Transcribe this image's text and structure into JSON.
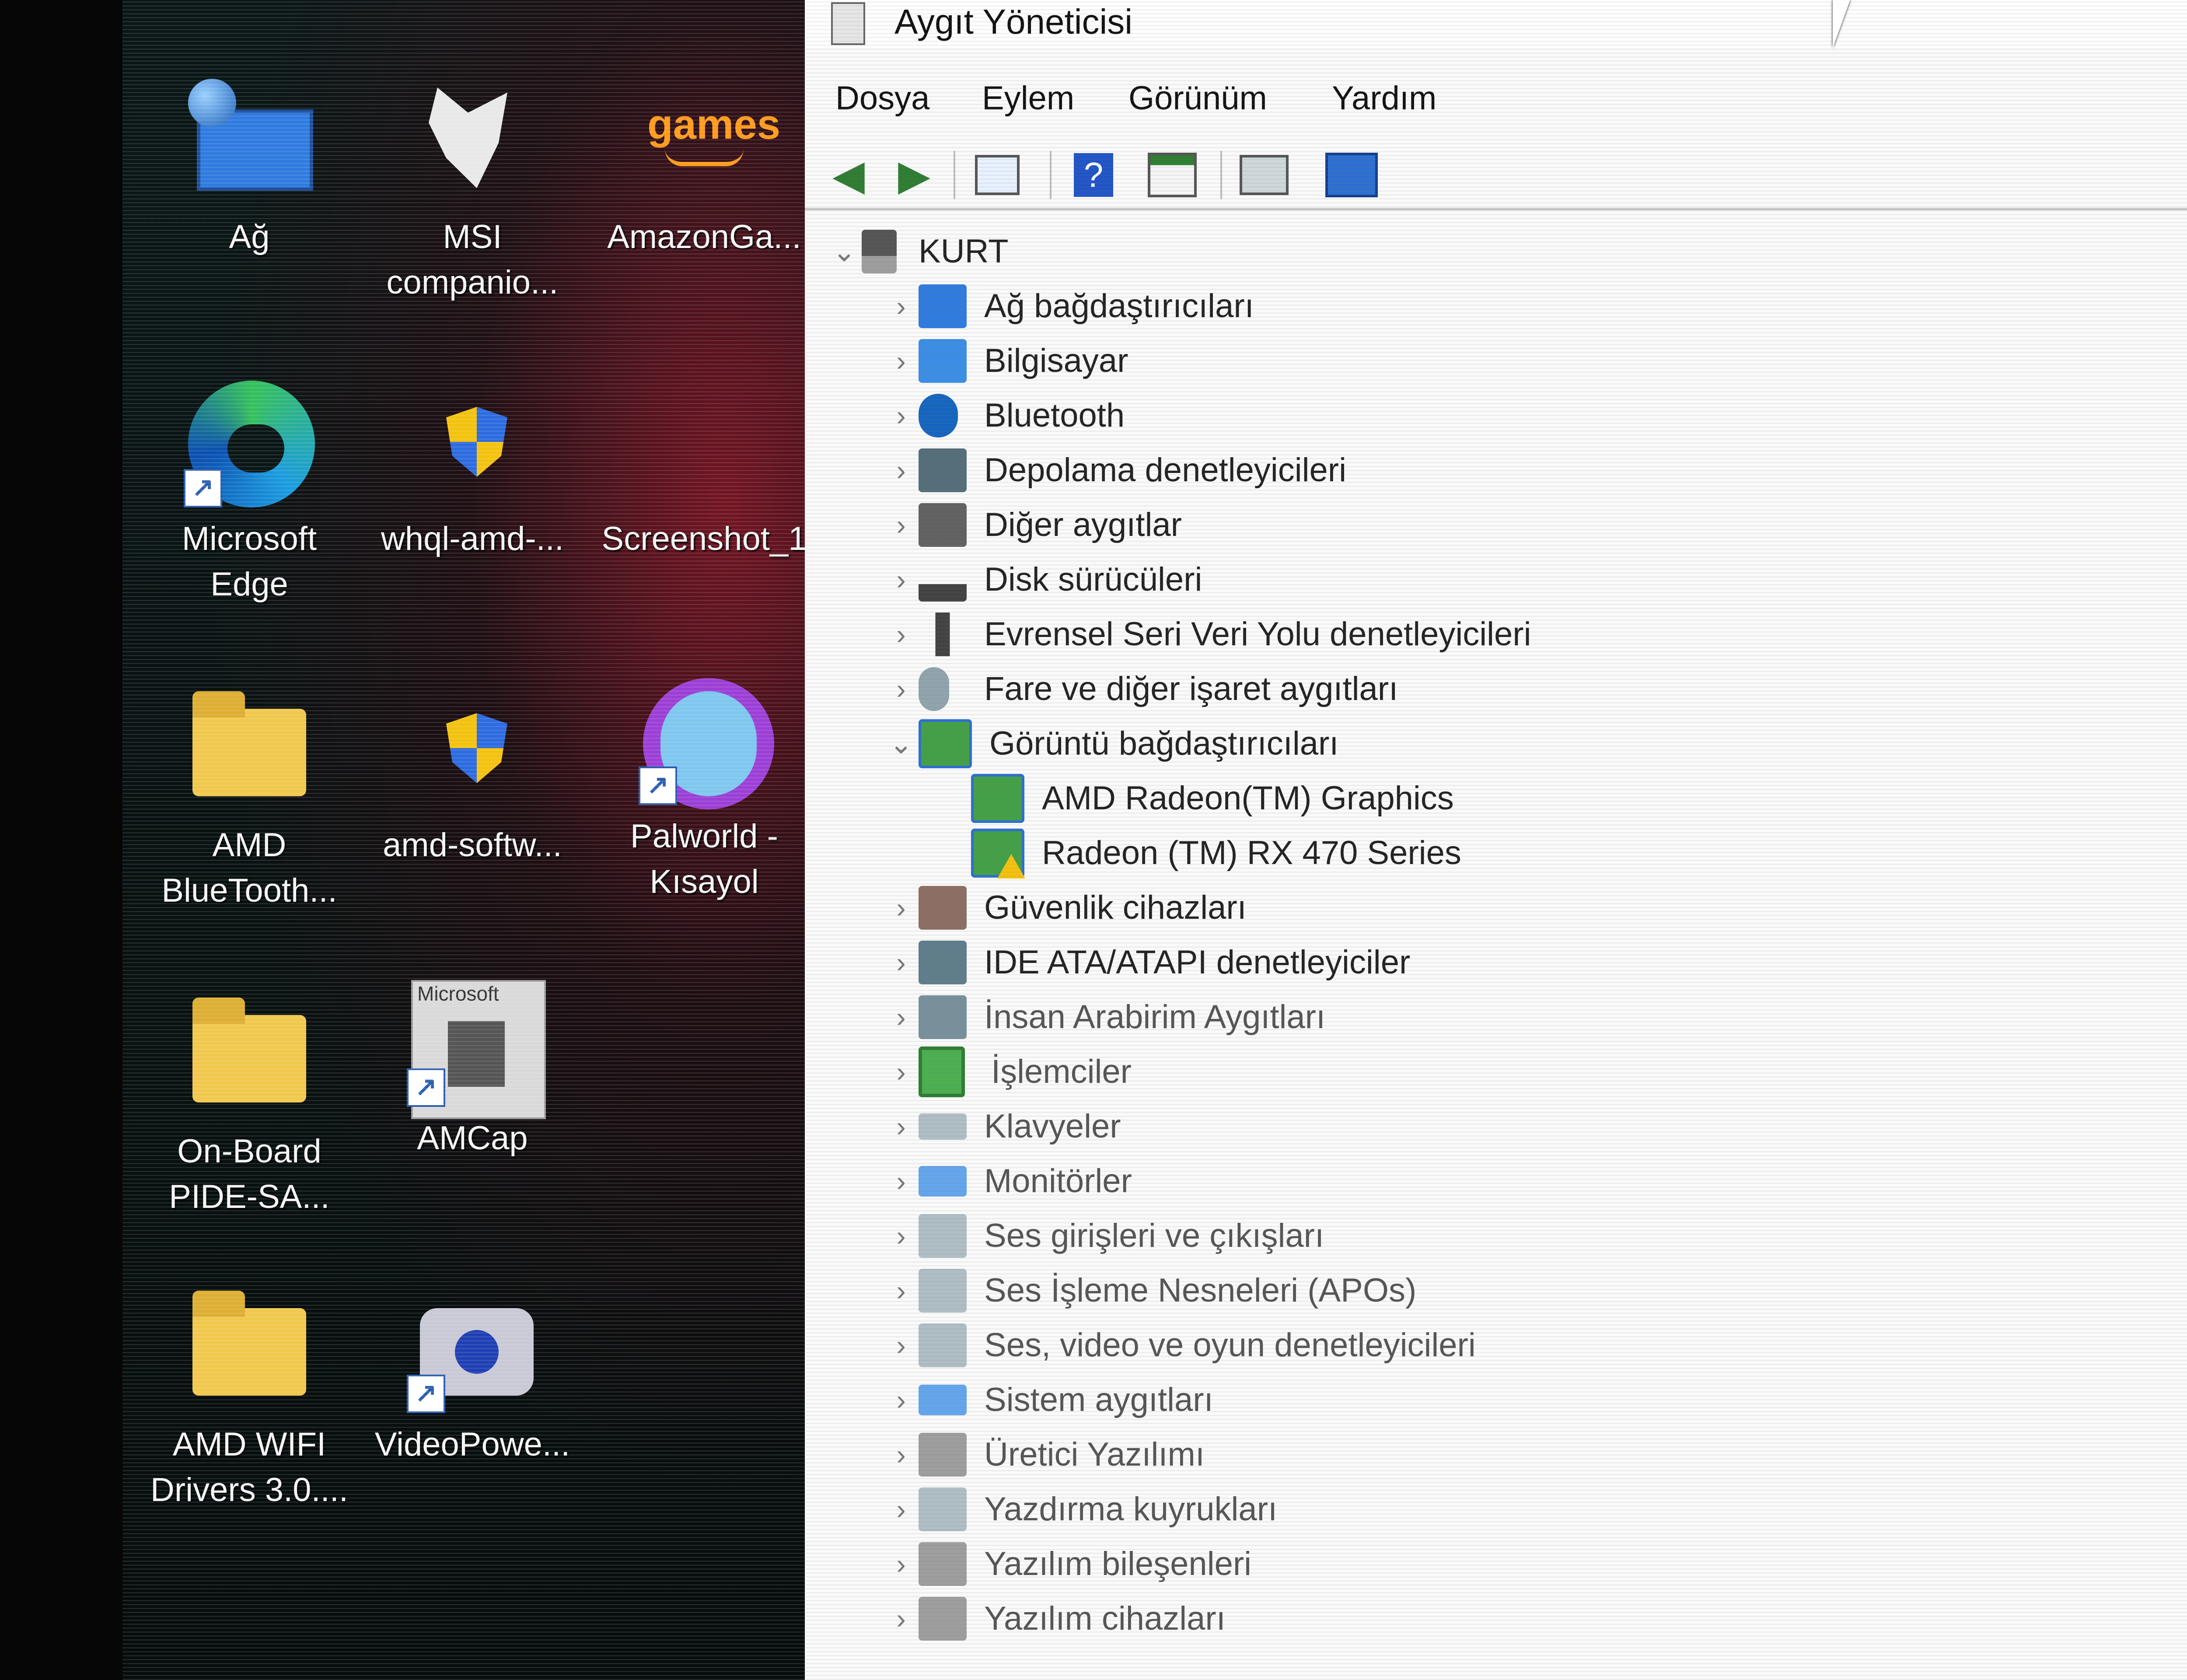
{
  "desktop": {
    "icons": [
      {
        "name": "ag",
        "label": "Ağ",
        "icon": "network-monitor-icon"
      },
      {
        "name": "msi-companion",
        "label": "MSI\ncompanio...",
        "icon": "msi-dragon-icon"
      },
      {
        "name": "amazon-games",
        "label": "AmazonGa...",
        "icon": "amazon-games-icon",
        "icon_text": "games"
      },
      {
        "name": "microsoft-edge",
        "label": "Microsoft\nEdge",
        "icon": "edge-icon"
      },
      {
        "name": "whql-amd",
        "label": "whql-amd-...",
        "icon": "shield-icon"
      },
      {
        "name": "screenshot",
        "label": "Screenshot_1",
        "icon": "image-icon"
      },
      {
        "name": "amd-bluetooth",
        "label": "AMD\nBlueTooth...",
        "icon": "folder-icon"
      },
      {
        "name": "amd-software",
        "label": "amd-softw...",
        "icon": "shield-icon"
      },
      {
        "name": "palworld",
        "label": "Palworld -\nKısayol",
        "icon": "palworld-icon"
      },
      {
        "name": "on-board-pide",
        "label": "On-Board\nPIDE-SA...",
        "icon": "folder-icon"
      },
      {
        "name": "amcap",
        "label": "AMCap",
        "icon": "amcap-icon",
        "icon_text": "Microsoft"
      },
      {
        "name": "amd-wifi",
        "label": "AMD WIFI\nDrivers 3.0....",
        "icon": "folder-icon"
      },
      {
        "name": "videopower",
        "label": "VideoPowe...",
        "icon": "webcam-icon"
      }
    ]
  },
  "window": {
    "title": "Aygıt Yöneticisi",
    "menu": [
      "Dosya",
      "Eylem",
      "Görünüm",
      "Yardım"
    ],
    "toolbar": [
      {
        "name": "back-button",
        "icon": "arrow-left-icon"
      },
      {
        "name": "forward-button",
        "icon": "arrow-right-icon"
      },
      {
        "name": "show-hide-console-tree-button",
        "icon": "console-tree-icon"
      },
      {
        "name": "help-button",
        "icon": "help-icon"
      },
      {
        "name": "properties-button",
        "icon": "properties-icon"
      },
      {
        "name": "scan-hardware-button",
        "icon": "scan-hardware-icon"
      },
      {
        "name": "monitor-button",
        "icon": "monitor-icon"
      }
    ],
    "tree": {
      "root": "KURT",
      "categories": [
        {
          "label": "Ağ bağdaştırıcıları",
          "icon": "network-adapter-icon",
          "expanded": false
        },
        {
          "label": "Bilgisayar",
          "icon": "computer-icon",
          "expanded": false
        },
        {
          "label": "Bluetooth",
          "icon": "bluetooth-icon",
          "expanded": false
        },
        {
          "label": "Depolama denetleyicileri",
          "icon": "storage-controller-icon",
          "expanded": false
        },
        {
          "label": "Diğer aygıtlar",
          "icon": "other-devices-icon",
          "expanded": false
        },
        {
          "label": "Disk sürücüleri",
          "icon": "disk-drive-icon",
          "expanded": false
        },
        {
          "label": "Evrensel Seri Veri Yolu denetleyicileri",
          "icon": "usb-icon",
          "expanded": false
        },
        {
          "label": "Fare ve diğer işaret aygıtları",
          "icon": "mouse-icon",
          "expanded": false
        },
        {
          "label": "Görüntü bağdaştırıcıları",
          "icon": "display-adapter-icon",
          "expanded": true,
          "children": [
            {
              "label": "AMD Radeon(TM) Graphics",
              "icon": "display-adapter-icon",
              "warning": false
            },
            {
              "label": "Radeon (TM) RX 470 Series",
              "icon": "display-adapter-icon",
              "warning": true
            }
          ]
        },
        {
          "label": "Güvenlik cihazları",
          "icon": "security-device-icon",
          "expanded": false
        },
        {
          "label": "IDE ATA/ATAPI denetleyiciler",
          "icon": "ide-controller-icon",
          "expanded": false
        },
        {
          "label": "İnsan Arabirim Aygıtları",
          "icon": "hid-icon",
          "expanded": false
        },
        {
          "label": "İşlemciler",
          "icon": "processor-icon",
          "expanded": false
        },
        {
          "label": "Klavyeler",
          "icon": "keyboard-icon",
          "expanded": false
        },
        {
          "label": "Monitörler",
          "icon": "monitor-icon",
          "expanded": false
        },
        {
          "label": "Ses girişleri ve çıkışları",
          "icon": "audio-io-icon",
          "expanded": false
        },
        {
          "label": "Ses İşleme Nesneleri (APOs)",
          "icon": "audio-processing-icon",
          "expanded": false
        },
        {
          "label": "Ses, video ve oyun denetleyicileri",
          "icon": "sound-video-icon",
          "expanded": false
        },
        {
          "label": "Sistem aygıtları",
          "icon": "system-devices-icon",
          "expanded": false
        },
        {
          "label": "Üretici Yazılımı",
          "icon": "firmware-icon",
          "expanded": false
        },
        {
          "label": "Yazdırma kuyrukları",
          "icon": "print-queue-icon",
          "expanded": false
        },
        {
          "label": "Yazılım bileşenleri",
          "icon": "software-component-icon",
          "expanded": false
        },
        {
          "label": "Yazılım cihazları",
          "icon": "software-device-icon",
          "expanded": false
        }
      ]
    }
  },
  "colors": {
    "desktop_bg": "#060c0c",
    "wallpaper_accent": "#961428",
    "window_bg": "#fafafa",
    "folder": "#f1c84d",
    "warning": "#f3c20f",
    "device_icon": "#3a7bd5"
  }
}
